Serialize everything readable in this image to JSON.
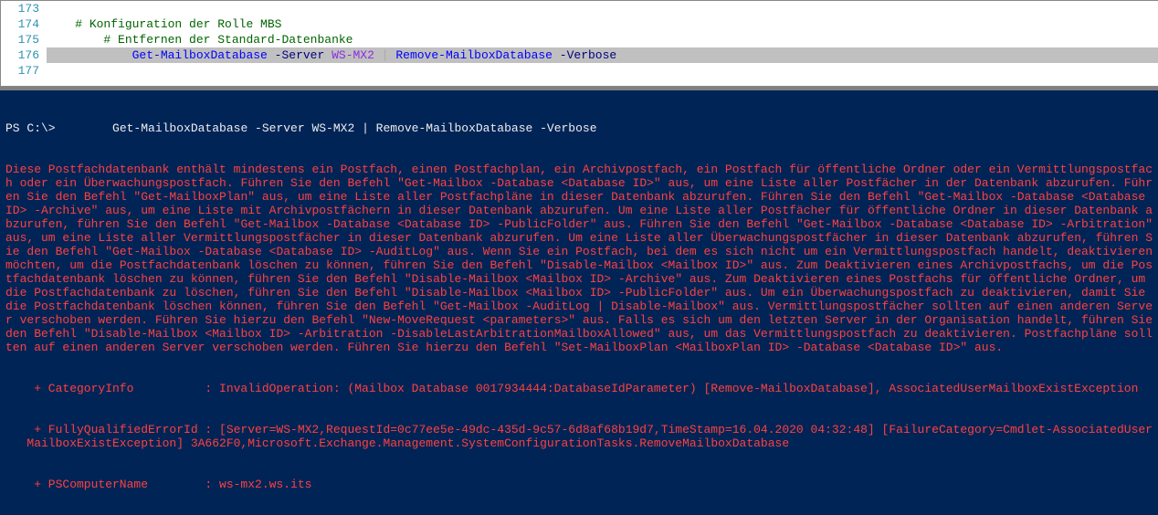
{
  "editor": {
    "lines": [
      {
        "num": 173,
        "tokens": []
      },
      {
        "num": 174,
        "tokens": [
          {
            "text": "    ",
            "cls": ""
          },
          {
            "text": "# Konfiguration der Rolle MBS",
            "cls": "tok-comment"
          }
        ]
      },
      {
        "num": 175,
        "tokens": [
          {
            "text": "        ",
            "cls": ""
          },
          {
            "text": "# Entfernen der Standard-Datenbanke",
            "cls": "tok-comment"
          }
        ]
      },
      {
        "num": 176,
        "selected": true,
        "tokens": [
          {
            "text": "            ",
            "cls": ""
          },
          {
            "text": "Get-MailboxDatabase",
            "cls": "tok-cmdlet"
          },
          {
            "text": " ",
            "cls": ""
          },
          {
            "text": "-Server",
            "cls": "tok-param"
          },
          {
            "text": " ",
            "cls": ""
          },
          {
            "text": "WS-MX2",
            "cls": "tok-value"
          },
          {
            "text": " ",
            "cls": ""
          },
          {
            "text": "|",
            "cls": "tok-op"
          },
          {
            "text": " ",
            "cls": ""
          },
          {
            "text": "Remove-MailboxDatabase",
            "cls": "tok-cmdlet"
          },
          {
            "text": " ",
            "cls": ""
          },
          {
            "text": "-Verbose",
            "cls": "tok-param"
          }
        ]
      },
      {
        "num": 177,
        "tokens": []
      }
    ]
  },
  "console": {
    "prompt": "PS C:\\>        Get-MailboxDatabase -Server WS-MX2 | Remove-MailboxDatabase -Verbose",
    "error_body": "Diese Postfachdatenbank enthält mindestens ein Postfach, einen Postfachplan, ein Archivpostfach, ein Postfach für öffentliche Ordner oder ein Vermittlungspostfach oder ein Überwachungspostfach. Führen Sie den Befehl \"Get-Mailbox -Database <Database ID>\" aus, um eine Liste aller Postfächer in der Datenbank abzurufen. Führen Sie den Befehl \"Get-MailboxPlan\" aus, um eine Liste aller Postfachpläne in dieser Datenbank abzurufen. Führen Sie den Befehl \"Get-Mailbox -Database <Database ID> -Archive\" aus, um eine Liste mit Archivpostfächern in dieser Datenbank abzurufen. Um eine Liste aller Postfächer für öffentliche Ordner in dieser Datenbank abzurufen, führen Sie den Befehl \"Get-Mailbox -Database <Database ID> -PublicFolder\" aus. Führen Sie den Befehl \"Get-Mailbox -Database <Database ID> -Arbitration\" aus, um eine Liste aller Vermittlungspostfächer in dieser Datenbank abzurufen. Um eine Liste aller Überwachungspostfächer in dieser Datenbank abzurufen, führen Sie den Befehl \"Get-Mailbox -Database <Database ID> -AuditLog\" aus. Wenn Sie ein Postfach, bei dem es sich nicht um ein Vermittlungspostfach handelt, deaktivieren möchten, um die Postfachdatenbank löschen zu können, führen Sie den Befehl \"Disable-Mailbox <Mailbox ID>\" aus. Zum Deaktivieren eines Archivpostfachs, um die Postfachdatenbank löschen zu können, führen Sie den Befehl \"Disable-Mailbox <Mailbox ID> -Archive\" aus. Zum Deaktivieren eines Postfachs für öffentliche Ordner, um die Postfachdatenbank zu löschen, führen Sie den Befehl \"Disable-Mailbox <Mailbox ID> -PublicFolder\" aus. Um ein Überwachungspostfach zu deaktivieren, damit Sie die Postfachdatenbank löschen können, führen Sie den Befehl \"Get-Mailbox -AuditLog | Disable-Mailbox\" aus. Vermittlungspostfächer sollten auf einen anderen Server verschoben werden. Führen Sie hierzu den Befehl \"New-MoveRequest <parameters>\" aus. Falls es sich um den letzten Server in der Organisation handelt, führen Sie den Befehl \"Disable-Mailbox <Mailbox ID> -Arbitration -DisableLastArbitrationMailboxAllowed\" aus, um das Vermittlungspostfach zu deaktivieren. Postfachpläne sollten auf einen anderen Server verschoben werden. Führen Sie hierzu den Befehl \"Set-MailboxPlan <MailboxPlan ID> -Database <Database ID>\" aus.",
    "category_info": "+ CategoryInfo          : InvalidOperation: (Mailbox Database 0017934444:DatabaseIdParameter) [Remove-MailboxDatabase], AssociatedUserMailboxExistException",
    "fq_error": "+ FullyQualifiedErrorId : [Server=WS-MX2,RequestId=0c77ee5e-49dc-435d-9c57-6d8af68b19d7,TimeStamp=16.04.2020 04:32:48] [FailureCategory=Cmdlet-AssociatedUserMailboxExistException] 3A662F0,Microsoft.Exchange.Management.SystemConfigurationTasks.RemoveMailboxDatabase",
    "ps_computer": "+ PSComputerName        : ws-mx2.ws.its"
  }
}
